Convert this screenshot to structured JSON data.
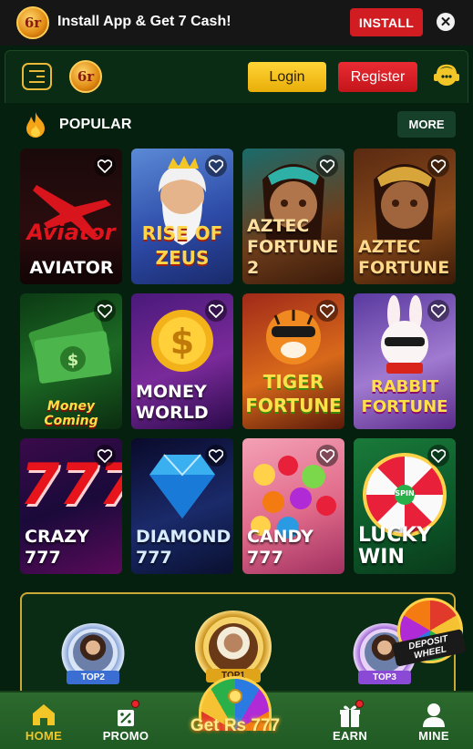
{
  "install_banner": {
    "logo_text": "6r",
    "text": "Install App & Get 7 Cash!",
    "install_label": "INSTALL",
    "close_glyph": "✕"
  },
  "header": {
    "logo_text": "6r",
    "login_label": "Login",
    "register_label": "Register"
  },
  "popular": {
    "title": "POPULAR",
    "more_label": "MORE"
  },
  "games": [
    {
      "name": "AVIATOR",
      "art_text": "Aviator"
    },
    {
      "name": "",
      "art_text": "RISE OF\nZEUS"
    },
    {
      "name": "AZTEC\nFORTUNE 2",
      "art_text": ""
    },
    {
      "name": "AZTEC\nFORTUNE",
      "art_text": ""
    },
    {
      "name": "",
      "art_text": "Money Coming"
    },
    {
      "name": "MONEY\nWORLD",
      "art_text": ""
    },
    {
      "name": "",
      "art_text": "TIGER\nFORTUNE"
    },
    {
      "name": "",
      "art_text": "RABBIT\nFORTUNE"
    },
    {
      "name": "CRAZY 777",
      "art_text": "777"
    },
    {
      "name": "DIAMOND\n777",
      "art_text": ""
    },
    {
      "name": "CANDY 777",
      "art_text": ""
    },
    {
      "name": "LUCKY\nWIN",
      "art_text": "SPIN"
    }
  ],
  "leaderboard": {
    "top1": "TOP1",
    "top2": "TOP2",
    "top3": "TOP3",
    "deposit_wheel_label": "DEPOSIT\nWHEEL"
  },
  "bottom_nav": {
    "home": "HOME",
    "promo": "PROMO",
    "center": "Get Rs 777",
    "earn": "EARN",
    "mine": "MINE"
  },
  "colors": {
    "background": "#06200f",
    "install_red": "#d11d22",
    "login_yellow": "#f3c628",
    "register_red": "#d61e25",
    "nav_green": "#2d6a2e",
    "active_nav": "#f3c628"
  },
  "icons": {
    "menu": "menu-icon",
    "chat": "chat-support-icon",
    "flame": "flame-icon",
    "heart": "heart-icon",
    "home": "home-icon",
    "promo": "gift-icon",
    "earn": "earn-gift-icon",
    "mine": "user-icon"
  }
}
